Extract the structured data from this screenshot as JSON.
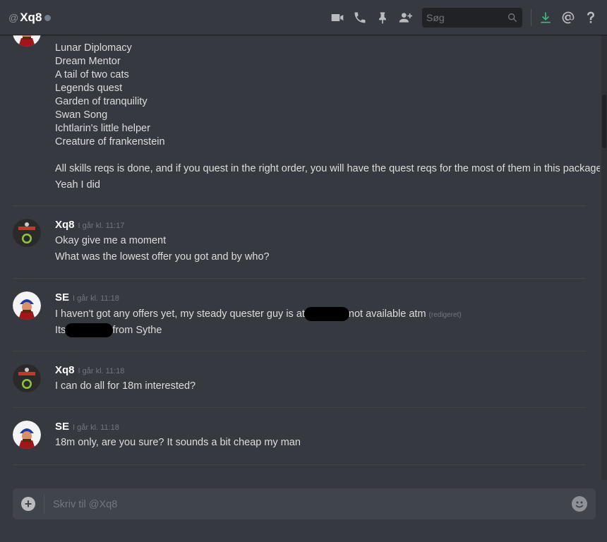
{
  "header": {
    "at_symbol": "@",
    "channel_name": "Xq8",
    "search_placeholder": "Søg",
    "icons": [
      "video-call-icon",
      "phone-call-icon",
      "pin-icon",
      "add-friend-icon",
      "search-icon",
      "download-icon",
      "mention-icon",
      "help-icon"
    ],
    "download_color": "#43b581"
  },
  "messages": {
    "group1": {
      "lines": [
        "Lunar Diplomacy",
        "Dream Mentor",
        "A tail of two cats",
        "Legends quest",
        "Garden of tranquility",
        "Swan Song",
        "Ichtlarin's little helper",
        "Creature of frankenstein",
        "All skills reqs is done, and if you quest in the right order, you will have the quest reqs for the most of them in this package",
        "Yeah I did"
      ]
    },
    "group2": {
      "author": "Xq8",
      "timestamp": "I går kl. 11:17",
      "lines": [
        "Okay give me a moment",
        "What was the lowest offer you got and by who?"
      ]
    },
    "group3": {
      "author": "SE",
      "timestamp": "I går kl. 11:18",
      "line1_part1": "I haven't got any offers yet, my steady quester guy is at",
      "line1_part2": "not available atm",
      "edited": "(redigeret)",
      "line2_part1": "Its",
      "line2_part2": "from Sythe"
    },
    "group4": {
      "author": "Xq8",
      "timestamp": "I går kl. 11:18",
      "lines": [
        "I can do all for 18m interested?"
      ]
    },
    "group5": {
      "author": "SE",
      "timestamp": "I går kl. 11:18",
      "lines": [
        "18m only, are you sure? It sounds a bit cheap my man"
      ]
    }
  },
  "composer": {
    "placeholder": "Skriv til @Xq8"
  },
  "colors": {
    "background": "#36393f",
    "accent_green": "#43b581",
    "text": "#dcddde"
  }
}
